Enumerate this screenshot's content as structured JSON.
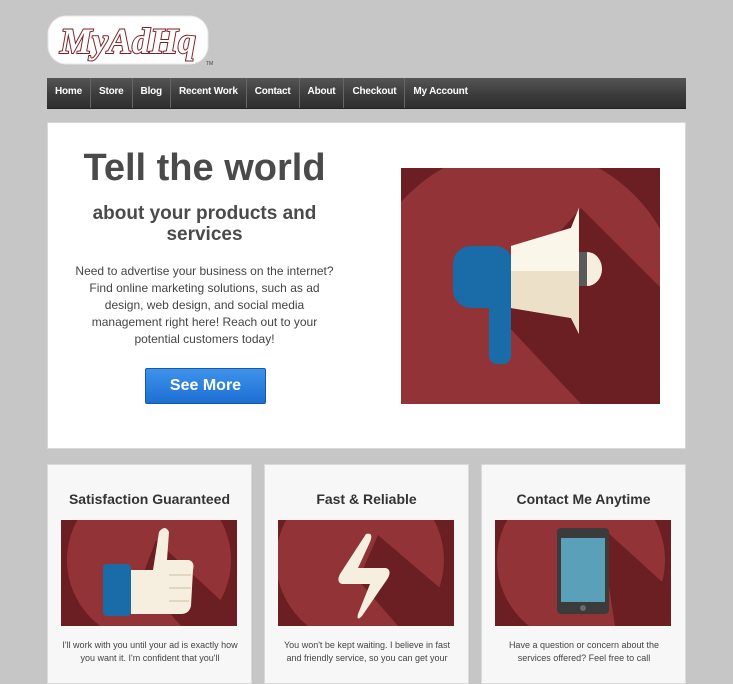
{
  "brand": {
    "logo_text": "MyAdHq",
    "tm": "TM"
  },
  "nav": {
    "items": [
      "Home",
      "Store",
      "Blog",
      "Recent Work",
      "Contact",
      "About",
      "Checkout",
      "My Account"
    ]
  },
  "hero": {
    "title": "Tell the world",
    "subtitle": "about your products and services",
    "body": "Need to advertise your business on the internet? Find online marketing solutions, such as ad design, web design, and social media management right here! Reach out to your potential customers today!",
    "button_label": "See More",
    "image_icon": "megaphone-icon"
  },
  "cards": [
    {
      "title": "Satisfaction Guaranteed",
      "icon": "thumbs-up-icon",
      "body": "I'll work with you until your ad is exactly how you want it. I'm confident that you'll"
    },
    {
      "title": "Fast & Reliable",
      "icon": "lightning-icon",
      "body": "You won't be kept waiting. I believe in fast and friendly service, so you can get your"
    },
    {
      "title": "Contact Me Anytime",
      "icon": "tablet-icon",
      "body": "Have a question or concern about the services offered? Feel free to call"
    }
  ],
  "colors": {
    "background": "#c6c6c6",
    "accent_red": "#8b2e30",
    "dark_red": "#6a1f22",
    "button_blue": "#2a7fe0",
    "icon_blue": "#1a6ca8",
    "cream": "#f8f1e0"
  }
}
